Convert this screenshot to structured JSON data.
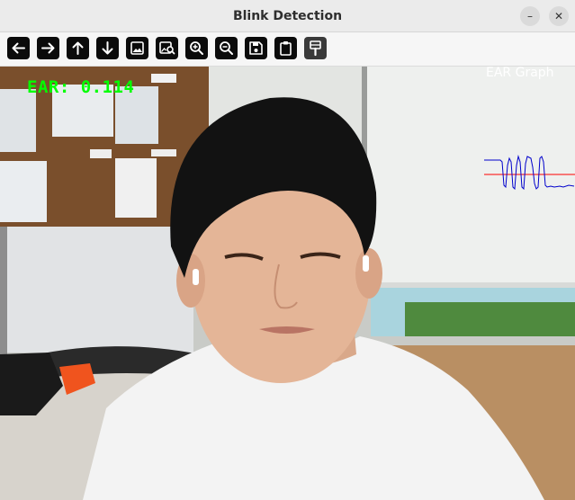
{
  "window": {
    "title": "Blink Detection",
    "minimize_glyph": "–",
    "close_glyph": "✕"
  },
  "toolbar": {
    "buttons": [
      {
        "name": "arrow-left-icon"
      },
      {
        "name": "arrow-right-icon"
      },
      {
        "name": "arrow-up-icon"
      },
      {
        "name": "arrow-down-icon"
      },
      {
        "name": "image-icon"
      },
      {
        "name": "image-search-icon"
      },
      {
        "name": "zoom-in-icon"
      },
      {
        "name": "zoom-out-icon"
      },
      {
        "name": "save-icon"
      },
      {
        "name": "clipboard-icon"
      },
      {
        "name": "properties-icon"
      }
    ]
  },
  "view": {
    "ear_text": "EAR: 0.114",
    "graph_title": "EAR Graph",
    "colors": {
      "ear_text": "#00ff00",
      "graph_line": "#0000cc",
      "threshold_line": "#ff0000",
      "graph_label": "#ffffff"
    }
  }
}
